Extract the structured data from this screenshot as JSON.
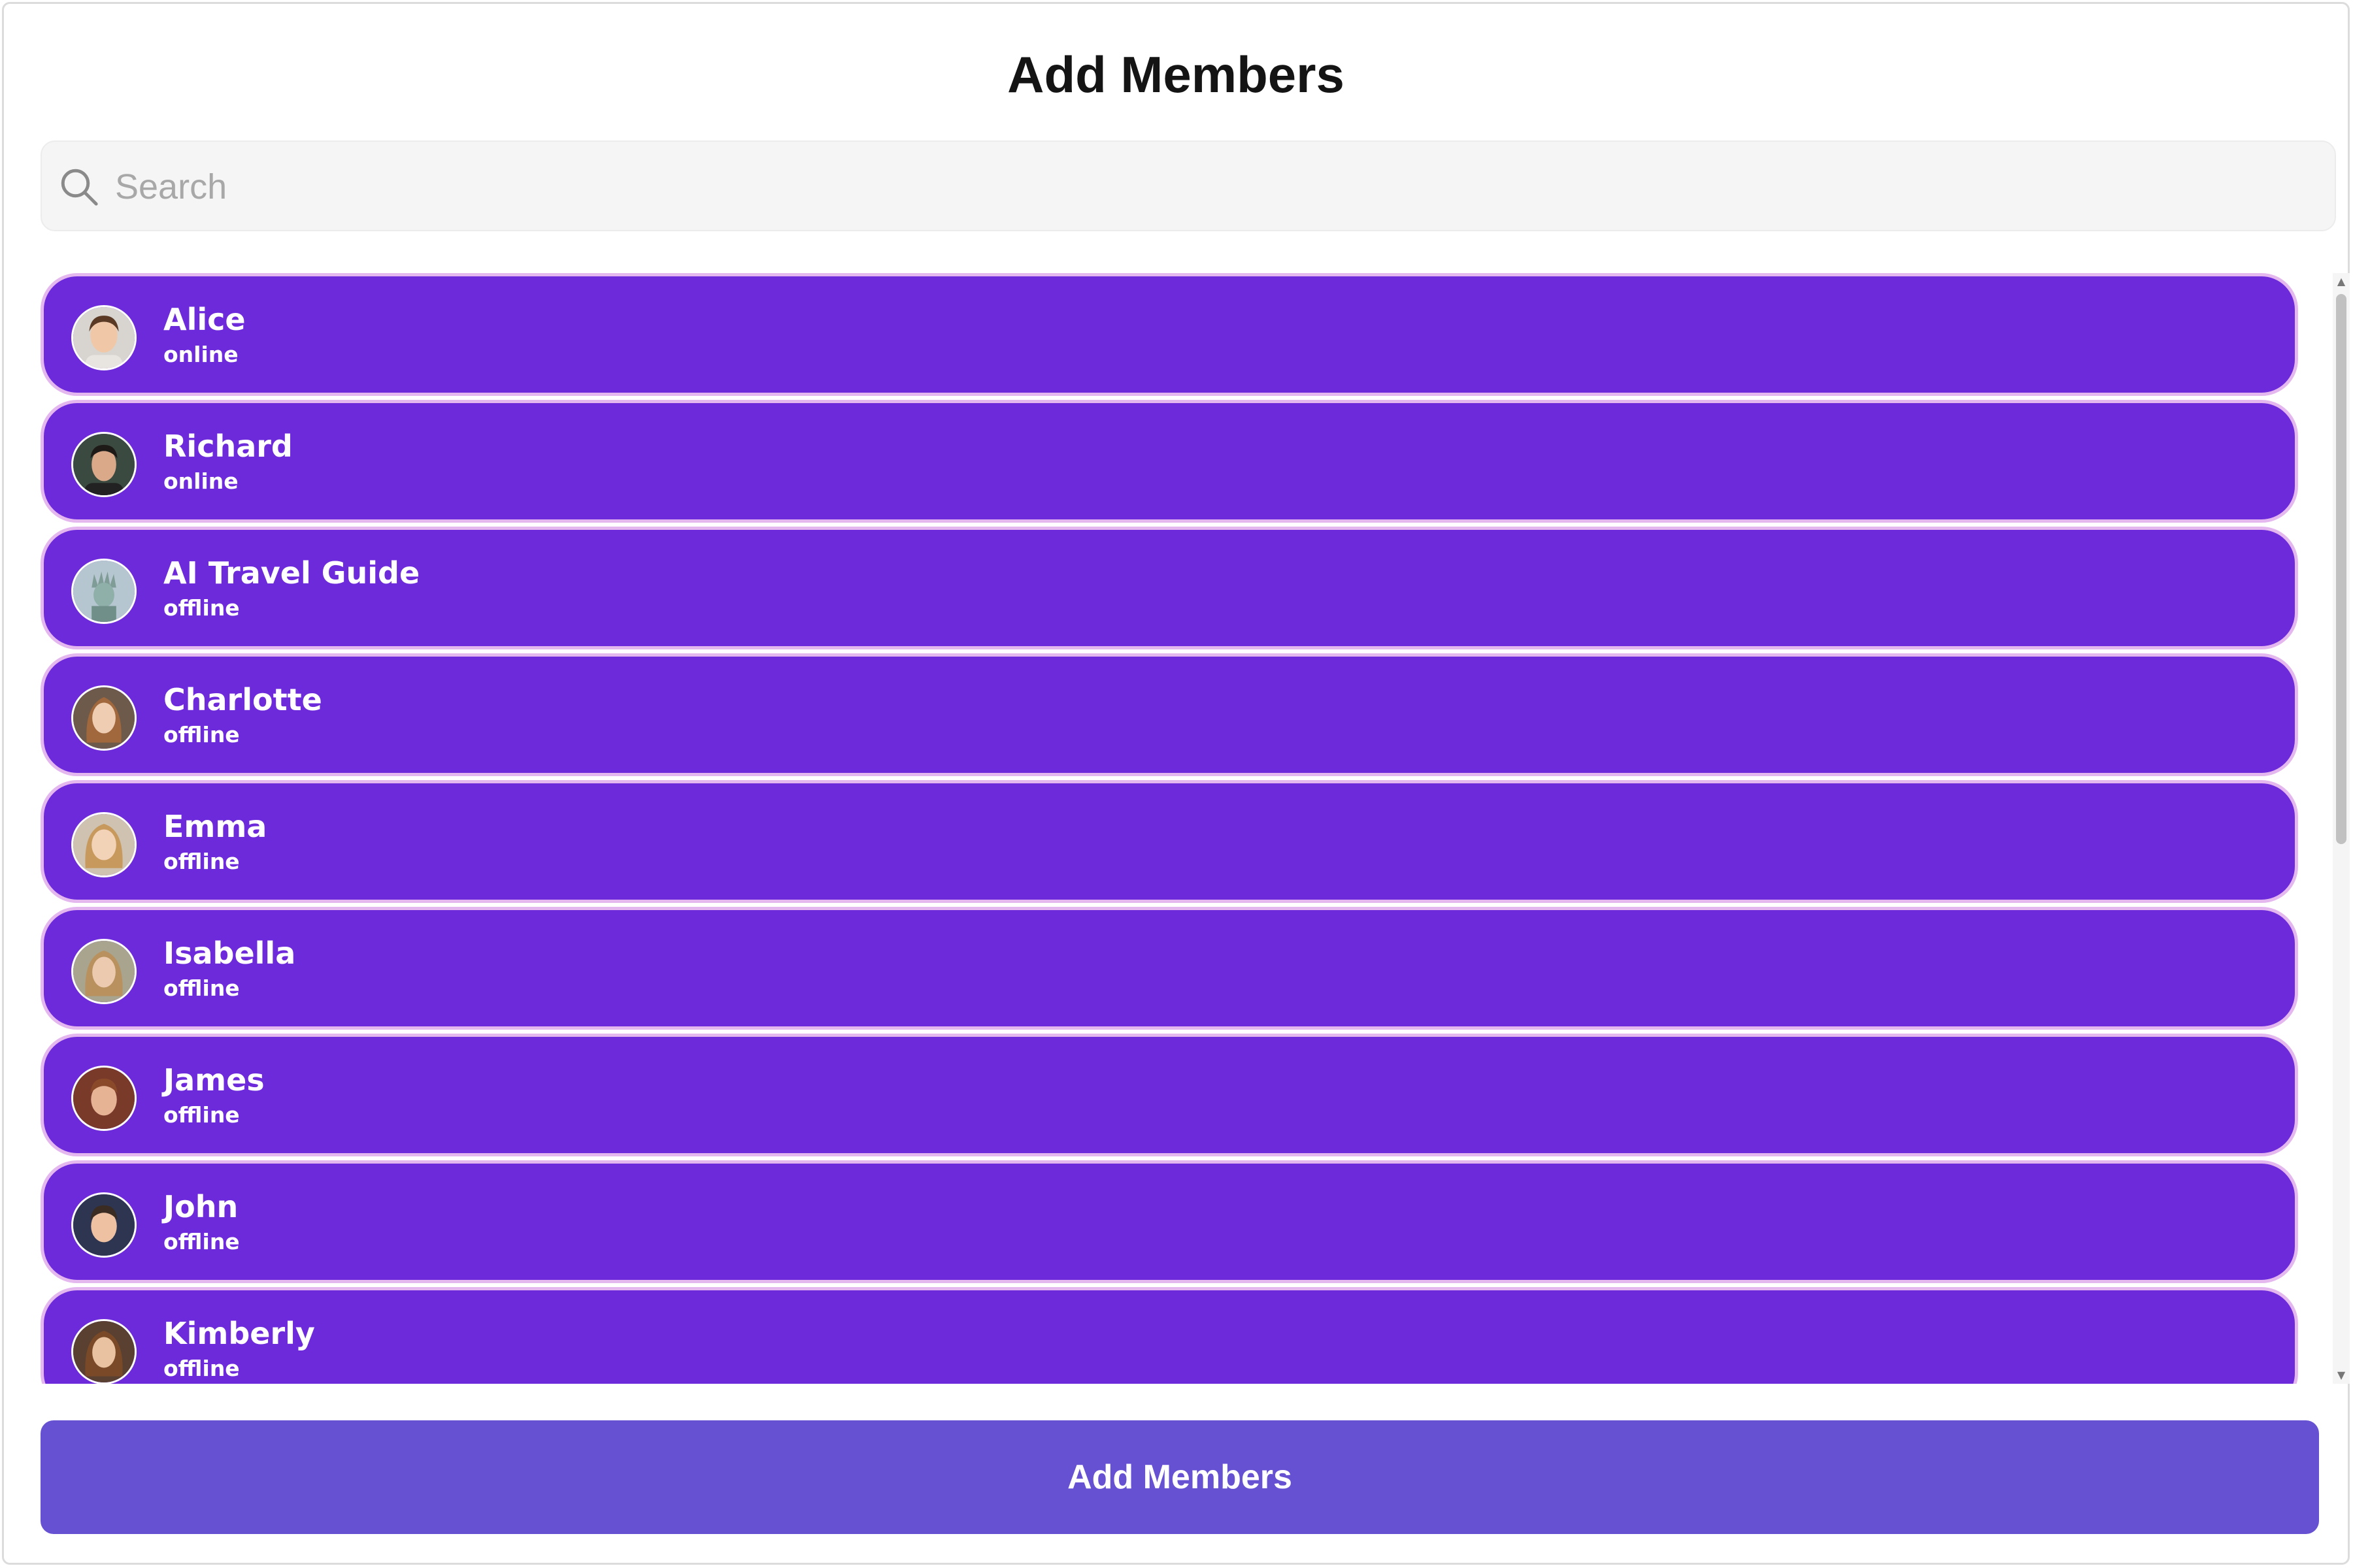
{
  "header": {
    "title": "Add Members"
  },
  "search": {
    "placeholder": "Search",
    "value": ""
  },
  "members": [
    {
      "name": "Alice",
      "status": "online"
    },
    {
      "name": "Richard",
      "status": "online"
    },
    {
      "name": "AI Travel Guide",
      "status": "offline"
    },
    {
      "name": "Charlotte",
      "status": "offline"
    },
    {
      "name": "Emma",
      "status": "offline"
    },
    {
      "name": "Isabella",
      "status": "offline"
    },
    {
      "name": "James",
      "status": "offline"
    },
    {
      "name": "John",
      "status": "offline"
    },
    {
      "name": "Kimberly",
      "status": "offline"
    }
  ],
  "footer": {
    "add_label": "Add Members"
  },
  "colors": {
    "member_background": "#6d2adb",
    "member_border": "#e4b8ef",
    "button_background": "#6751d3",
    "text_on_accent": "#ffffff"
  },
  "icons": {
    "search": "search-icon",
    "avatar": "avatar"
  }
}
